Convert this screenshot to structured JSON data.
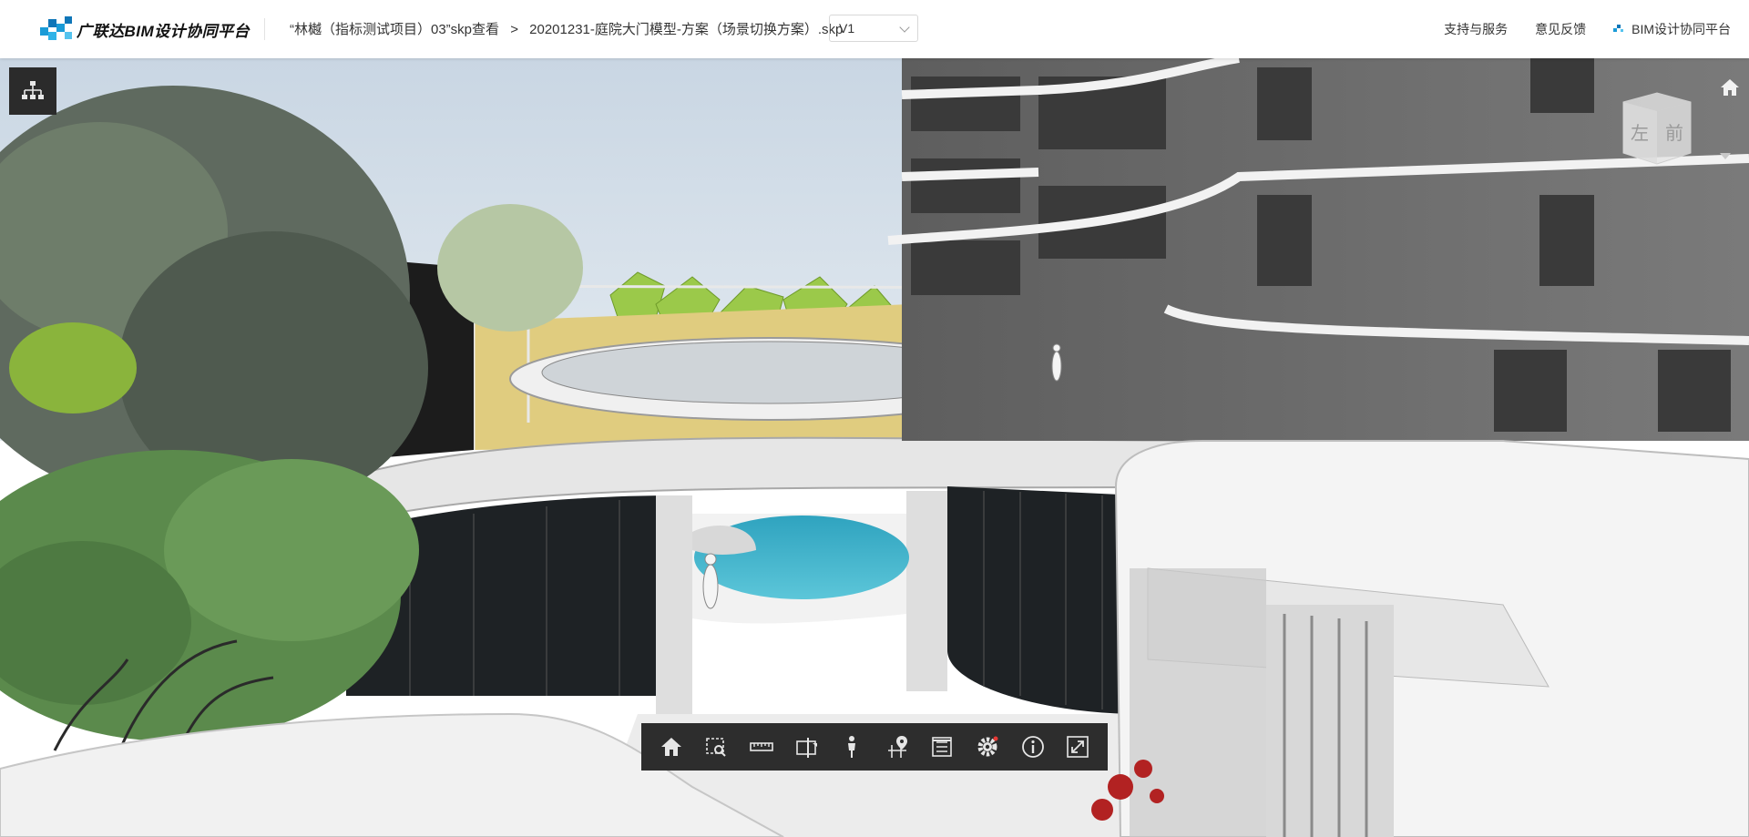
{
  "header": {
    "logo_text": "广联达BIM设计协同平台",
    "breadcrumb_project": "“林樾（指标测试项目）03”skp查看",
    "breadcrumb_separator": ">",
    "breadcrumb_file": "20201231-庭院大门模型-方案（场景切换方案）.skp",
    "version": "V1",
    "links": {
      "support": "支持与服务",
      "feedback": "意见反馈",
      "platform": "BIM设计协同平台"
    }
  },
  "viewcube": {
    "left_label": "左",
    "front_label": "前"
  },
  "toolbar": {
    "items": [
      "home-icon",
      "zoom-window-icon",
      "measure-icon",
      "section-icon",
      "person-icon",
      "location-icon",
      "list-icon",
      "settings-icon",
      "info-icon",
      "fullscreen-icon"
    ]
  },
  "colors": {
    "accent": "#1a9bd7",
    "toolbar_bg": "#2d2d2d",
    "sky": "#d6e0ea"
  }
}
